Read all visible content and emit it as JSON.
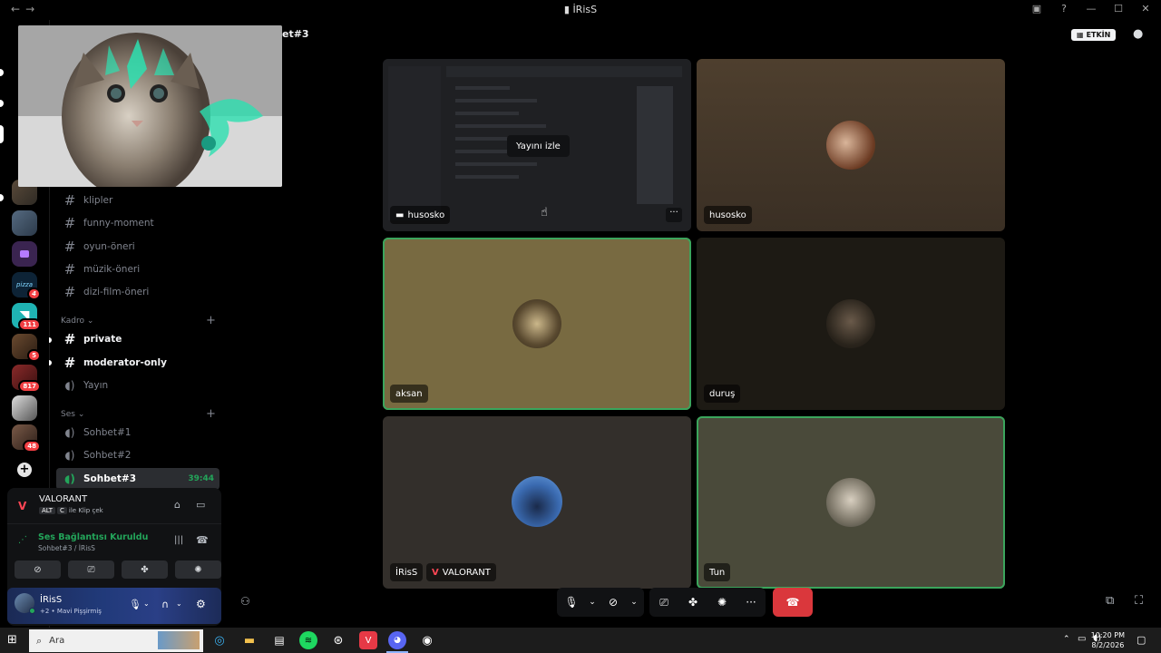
{
  "window": {
    "title": "İRisS"
  },
  "header": {
    "channel_title_partial": "et#3",
    "activity_badge": "ETKİN"
  },
  "guilds": {
    "badges": [
      "4",
      "111",
      "5",
      "817",
      "48"
    ]
  },
  "sidebar": {
    "channels": [
      {
        "name": "klipler"
      },
      {
        "name": "funny-moment"
      },
      {
        "name": "oyun-öneri"
      },
      {
        "name": "müzik-öneri"
      },
      {
        "name": "dizi-film-öneri"
      }
    ],
    "kadro": {
      "label": "Kadro",
      "channels": [
        {
          "name": "private"
        },
        {
          "name": "moderator-only"
        },
        {
          "name": "Yayın"
        }
      ]
    },
    "ses": {
      "label": "Ses",
      "channels": [
        {
          "name": "Sohbet#1"
        },
        {
          "name": "Sohbet#2"
        },
        {
          "name": "Sohbet#3",
          "timer": "39:44"
        }
      ]
    }
  },
  "activity_panel": {
    "game": "VALORANT",
    "clip_hint": "ile Klip çek",
    "key_alt": "ALT",
    "key_c": "C",
    "voice_status": "Ses Bağlantısı Kuruldu",
    "voice_location": "Sohbet#3 / İRisS"
  },
  "user_panel": {
    "name": "İRisS",
    "status": "+2 • Mavi Pişşirmiş"
  },
  "stage": {
    "tiles": [
      {
        "name": "husosko",
        "overlay_button": "Yayını izle",
        "streaming": true
      },
      {
        "name": "husosko"
      },
      {
        "name": "aksan",
        "speaking": true
      },
      {
        "name": "duruş"
      },
      {
        "name": "İRisS",
        "game_tag": "VALORANT"
      },
      {
        "name": "Tun",
        "speaking": true
      }
    ]
  },
  "taskbar": {
    "search_placeholder": "Ara",
    "time": "10:20 PM",
    "date": "8/2/2026"
  },
  "colors": {
    "accent_green": "#23a55a",
    "danger": "#da373c",
    "tile_olive": "#786a41",
    "tile_brown": "#4b3d2d"
  }
}
